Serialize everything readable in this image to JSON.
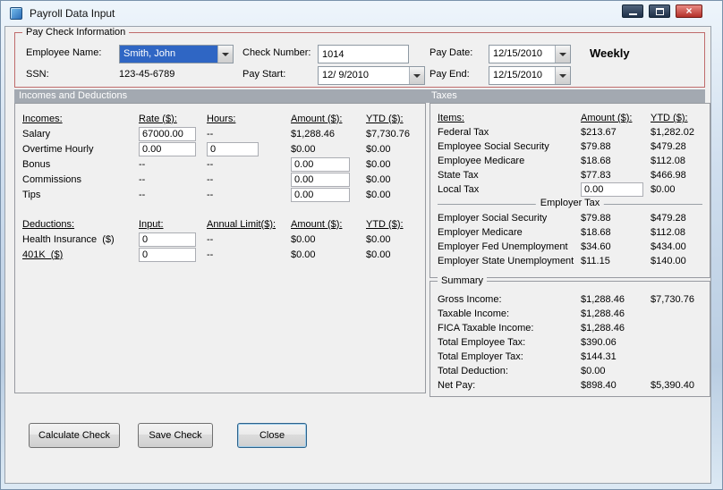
{
  "window": {
    "title": "Payroll Data Input",
    "close_glyph": "×"
  },
  "paycheck": {
    "group_label": "Pay Check Information",
    "employee_name_label": "Employee Name:",
    "employee_name_value": "Smith, John",
    "ssn_label": "SSN:",
    "ssn_value": "123-45-6789",
    "check_number_label": "Check Number:",
    "check_number_value": "1014",
    "pay_start_label": "Pay Start:",
    "pay_start_value": "12/ 9/2010",
    "pay_date_label": "Pay Date:",
    "pay_date_value": "12/15/2010",
    "pay_end_label": "Pay End:",
    "pay_end_value": "12/15/2010",
    "frequency": "Weekly"
  },
  "sections": {
    "incomes_deductions": "Incomes and Deductions",
    "taxes": "Taxes"
  },
  "incomes": {
    "headers": {
      "name": "Incomes:",
      "rate": "Rate ($):",
      "hours": "Hours:",
      "amount": "Amount ($):",
      "ytd": "YTD ($):"
    },
    "rows": [
      {
        "name": "Salary",
        "rate": "67000.00",
        "hours": "--",
        "amount": "$1,288.46",
        "ytd": "$7,730.76"
      },
      {
        "name": "Overtime Hourly",
        "rate": "0.00",
        "hours": "0",
        "amount": "$0.00",
        "ytd": "$0.00"
      },
      {
        "name": "Bonus",
        "rate": "--",
        "hours": "--",
        "amount": "0.00",
        "ytd": "$0.00"
      },
      {
        "name": "Commissions",
        "rate": "--",
        "hours": "--",
        "amount": "0.00",
        "ytd": "$0.00"
      },
      {
        "name": "Tips",
        "rate": "--",
        "hours": "--",
        "amount": "0.00",
        "ytd": "$0.00"
      }
    ]
  },
  "deductions": {
    "headers": {
      "name": "Deductions:",
      "input": "Input:",
      "limit": "Annual Limit($):",
      "amount": "Amount ($):",
      "ytd": "YTD ($):"
    },
    "rows": [
      {
        "name": "Health Insurance  ($)",
        "input": "0",
        "limit": "--",
        "amount": "$0.00",
        "ytd": "$0.00"
      },
      {
        "name": "401K  ($)",
        "input": "0",
        "limit": "--",
        "amount": "$0.00",
        "ytd": "$0.00"
      }
    ]
  },
  "taxes": {
    "headers": {
      "item": "Items:",
      "amount": "Amount ($):",
      "ytd": "YTD ($):"
    },
    "employee_rows": [
      {
        "item": "Federal Tax",
        "amount": "$213.67",
        "ytd": "$1,282.02"
      },
      {
        "item": "Employee Social Security",
        "amount": "$79.88",
        "ytd": "$479.28"
      },
      {
        "item": "Employee Medicare",
        "amount": "$18.68",
        "ytd": "$112.08"
      },
      {
        "item": "State Tax",
        "amount": "$77.83",
        "ytd": "$466.98"
      },
      {
        "item": "Local Tax",
        "amount": "0.00",
        "ytd": "$0.00"
      }
    ],
    "employer_label": "Employer Tax",
    "employer_rows": [
      {
        "item": "Employer Social Security",
        "amount": "$79.88",
        "ytd": "$479.28"
      },
      {
        "item": "Employer Medicare",
        "amount": "$18.68",
        "ytd": "$112.08"
      },
      {
        "item": "Employer Fed Unemployment",
        "amount": "$34.60",
        "ytd": "$434.00"
      },
      {
        "item": "Employer State Unemployment",
        "amount": "$11.15",
        "ytd": "$140.00"
      }
    ]
  },
  "summary": {
    "label": "Summary",
    "rows": [
      {
        "item": "Gross Income:",
        "amount": "$1,288.46",
        "ytd": "$7,730.76"
      },
      {
        "item": "Taxable Income:",
        "amount": "$1,288.46",
        "ytd": ""
      },
      {
        "item": "FICA Taxable Income:",
        "amount": "$1,288.46",
        "ytd": ""
      },
      {
        "item": "Total Employee Tax:",
        "amount": "$390.06",
        "ytd": ""
      },
      {
        "item": "Total Employer Tax:",
        "amount": "$144.31",
        "ytd": ""
      },
      {
        "item": "Total Deduction:",
        "amount": "$0.00",
        "ytd": ""
      },
      {
        "item": "Net Pay:",
        "amount": "$898.40",
        "ytd": "$5,390.40"
      }
    ]
  },
  "buttons": {
    "calculate": "Calculate Check",
    "save": "Save Check",
    "close": "Close"
  },
  "colors": {
    "group_border": "#bf6b6b",
    "section_bar": "#a3a9b1",
    "combo_selected": "#2f66c4"
  }
}
